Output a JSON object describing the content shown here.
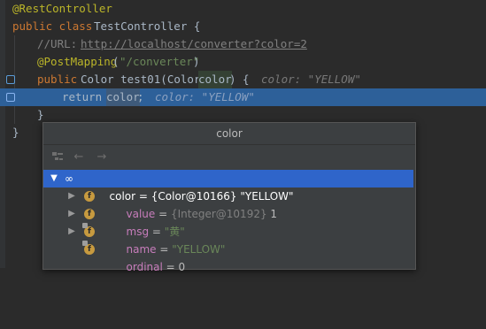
{
  "editor": {
    "lines": [
      {
        "annotation": "@RestController"
      },
      {
        "kw1": "public class",
        "name": "TestController {"
      },
      {
        "comment": "//URL: ",
        "link": "http://localhost/converter?color=2"
      },
      {
        "annotation": "@PostMapping",
        "open": "(",
        "str": "\"/converter\"",
        "close": ")"
      },
      {
        "kw1": "public",
        "sig": "Color test01(Color ",
        "param": "color",
        "end": ") {",
        "inlay": "color: \"YELLOW\""
      },
      {
        "kw1": "return",
        "ret": "color",
        "semi": ";",
        "inlay": "color: \"YELLOW\""
      },
      {
        "brace": "}"
      },
      {
        "brace": "}"
      }
    ]
  },
  "popup": {
    "title": "color",
    "toolbar": {
      "icons": [
        "tree-table-icon",
        "back-arrow-icon",
        "forward-arrow-icon"
      ]
    },
    "tree": {
      "root": {
        "name": "color",
        "value": "{Color@10166} \"YELLOW\""
      },
      "children": [
        {
          "name": "value",
          "value_prefix": "{Integer@10192}",
          "value": "1",
          "icon": "f",
          "expandable": true
        },
        {
          "name": "msg",
          "value": "\"黄\"",
          "icon": "f",
          "expandable": true
        },
        {
          "name": "name",
          "value": "\"YELLOW\"",
          "icon": "f",
          "expandable": true
        },
        {
          "name": "ordinal",
          "value": "0",
          "icon": "f",
          "expandable": false
        }
      ]
    }
  },
  "colors": {
    "background": "#2b2b2b",
    "keyword": "#cc7832",
    "annotation": "#bbb529",
    "string": "#6a8759",
    "current_line": "#2d6099",
    "selection": "#2f65ca"
  }
}
